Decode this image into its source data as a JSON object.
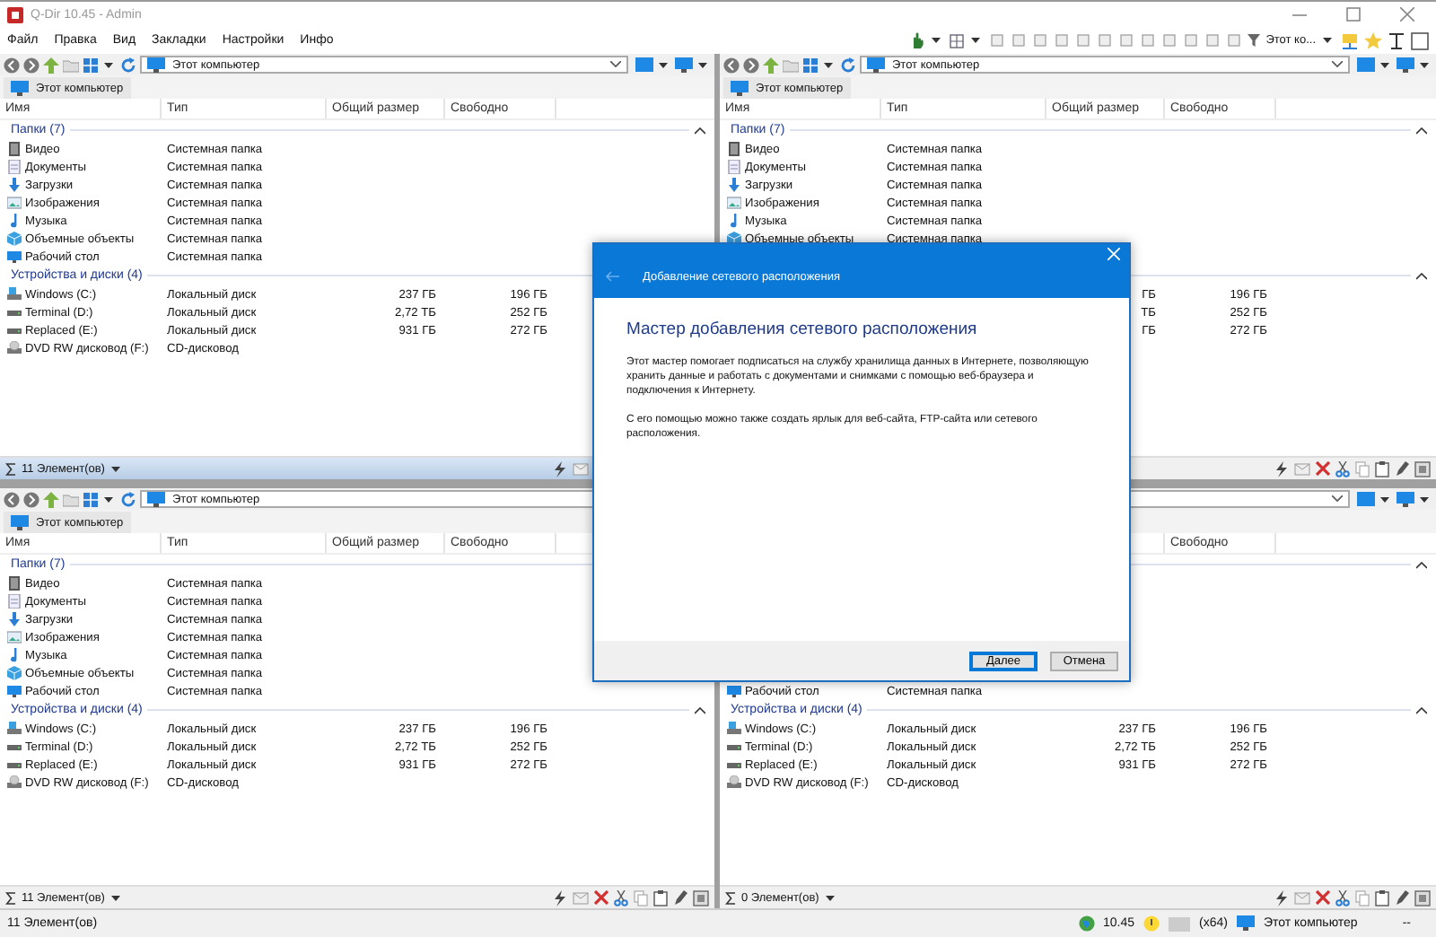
{
  "window": {
    "title": "Q-Dir 10.45 - Admin"
  },
  "menu": [
    "Файл",
    "Правка",
    "Вид",
    "Закладки",
    "Настройки",
    "Инфо"
  ],
  "toolbar": {
    "location_label": "Этот ко..."
  },
  "panes": [
    {
      "active": true,
      "address": "Этот компьютер",
      "tab": "Этот компьютер",
      "columns": {
        "name": "Имя",
        "type": "Тип",
        "size": "Общий размер",
        "free": "Свободно"
      },
      "groups": [
        {
          "title": "Папки (7)",
          "items": [
            {
              "kind": "video",
              "name": "Видео",
              "type": "Системная папка"
            },
            {
              "kind": "documents",
              "name": "Документы",
              "type": "Системная папка"
            },
            {
              "kind": "downloads",
              "name": "Загрузки",
              "type": "Системная папка"
            },
            {
              "kind": "pictures",
              "name": "Изображения",
              "type": "Системная папка"
            },
            {
              "kind": "music",
              "name": "Музыка",
              "type": "Системная папка"
            },
            {
              "kind": "objects",
              "name": "Объемные объекты",
              "type": "Системная папка"
            },
            {
              "kind": "desktop",
              "name": "Рабочий стол",
              "type": "Системная папка"
            }
          ]
        },
        {
          "title": "Устройства и диски (4)",
          "items": [
            {
              "kind": "system-drive",
              "name": "Windows (C:)",
              "type": "Локальный диск",
              "size": "237 ГБ",
              "free": "196 ГБ"
            },
            {
              "kind": "drive",
              "name": "Terminal (D:)",
              "type": "Локальный диск",
              "size": "2,72 ТБ",
              "free": "252 ГБ"
            },
            {
              "kind": "drive",
              "name": "Replaced (E:)",
              "type": "Локальный диск",
              "size": "931 ГБ",
              "free": "272 ГБ"
            },
            {
              "kind": "dvd",
              "name": "DVD RW дисковод (F:)",
              "type": "CD-дисковод"
            }
          ]
        }
      ],
      "status": "11 Элемент(ов)"
    },
    {
      "active": false,
      "address": "Этот компьютер",
      "tab": "Этот компьютер",
      "columns": {
        "name": "Имя",
        "type": "Тип",
        "size": "Общий размер",
        "free": "Свободно"
      },
      "groups": [
        {
          "title": "Папки (7)",
          "items": [
            {
              "kind": "video",
              "name": "Видео",
              "type": "Системная папка"
            },
            {
              "kind": "documents",
              "name": "Документы",
              "type": "Системная папка"
            },
            {
              "kind": "downloads",
              "name": "Загрузки",
              "type": "Системная папка"
            },
            {
              "kind": "pictures",
              "name": "Изображения",
              "type": "Системная папка"
            },
            {
              "kind": "music",
              "name": "Музыка",
              "type": "Системная папка"
            },
            {
              "kind": "objects",
              "name": "Объемные объекты",
              "type": "Системная папка"
            }
          ]
        },
        {
          "items": [
            {
              "size": "ГБ",
              "free": "196 ГБ"
            },
            {
              "size": "ТБ",
              "free": "252 ГБ"
            },
            {
              "size": "ГБ",
              "free": "272 ГБ"
            }
          ]
        }
      ]
    },
    {
      "active": false,
      "address": "Этот компьютер",
      "tab": "Этот компьютер",
      "columns": {
        "name": "Имя",
        "type": "Тип",
        "size": "Общий размер",
        "free": "Свободно"
      },
      "groups": [
        {
          "title": "Папки (7)",
          "items": [
            {
              "kind": "video",
              "name": "Видео",
              "type": "Системная папка"
            },
            {
              "kind": "documents",
              "name": "Документы",
              "type": "Системная папка"
            },
            {
              "kind": "downloads",
              "name": "Загрузки",
              "type": "Системная папка"
            },
            {
              "kind": "pictures",
              "name": "Изображения",
              "type": "Системная папка"
            },
            {
              "kind": "music",
              "name": "Музыка",
              "type": "Системная папка"
            },
            {
              "kind": "objects",
              "name": "Объемные объекты",
              "type": "Системная папка"
            },
            {
              "kind": "desktop",
              "name": "Рабочий стол",
              "type": "Системная папка"
            }
          ]
        },
        {
          "title": "Устройства и диски (4)",
          "items": [
            {
              "kind": "system-drive",
              "name": "Windows (C:)",
              "type": "Локальный диск",
              "size": "237 ГБ",
              "free": "196 ГБ"
            },
            {
              "kind": "drive",
              "name": "Terminal (D:)",
              "type": "Локальный диск",
              "size": "2,72 ТБ",
              "free": "252 ГБ"
            },
            {
              "kind": "drive",
              "name": "Replaced (E:)",
              "type": "Локальный диск",
              "size": "931 ГБ",
              "free": "272 ГБ"
            },
            {
              "kind": "dvd",
              "name": "DVD RW дисковод (F:)",
              "type": "CD-дисковод"
            }
          ]
        }
      ],
      "status": "11 Элемент(ов)"
    },
    {
      "active": false,
      "columns": {
        "free": "Свободно"
      },
      "groups": [
        {
          "items": [
            {
              "kind": "desktop",
              "name": "Рабочий стол",
              "type": "Системная папка"
            }
          ]
        },
        {
          "title": "Устройства и диски (4)",
          "items": [
            {
              "kind": "system-drive",
              "name": "Windows (C:)",
              "type": "Локальный диск",
              "size": "237 ГБ",
              "free": "196 ГБ"
            },
            {
              "kind": "drive",
              "name": "Terminal (D:)",
              "type": "Локальный диск",
              "size": "2,72 ТБ",
              "free": "252 ГБ"
            },
            {
              "kind": "drive",
              "name": "Replaced (E:)",
              "type": "Локальный диск",
              "size": "931 ГБ",
              "free": "272 ГБ"
            },
            {
              "kind": "dvd",
              "name": "DVD RW дисковод (F:)",
              "type": "CD-дисковод"
            }
          ]
        }
      ],
      "status": "0 Элемент(ов)"
    }
  ],
  "status_bar": {
    "items": "11 Элемент(ов)",
    "version": "10.45",
    "arch": "(x64)",
    "location": "Этот компьютер",
    "extra": "--"
  },
  "dialog": {
    "title": "Добавление сетевого расположения",
    "heading": "Мастер добавления сетевого расположения",
    "paragraphs": [
      "Этот мастер помогает подписаться на службу хранилища данных в Интернете, позволяющую хранить данные и работать с документами и снимками с помощью веб-браузера и подключения к Интернету.",
      "С его помощью можно также создать ярлык для веб-сайта, FTP-сайта или сетевого расположения."
    ],
    "buttons": [
      {
        "label": "Далее",
        "default": true
      },
      {
        "label": "Отмена",
        "default": false
      }
    ]
  }
}
